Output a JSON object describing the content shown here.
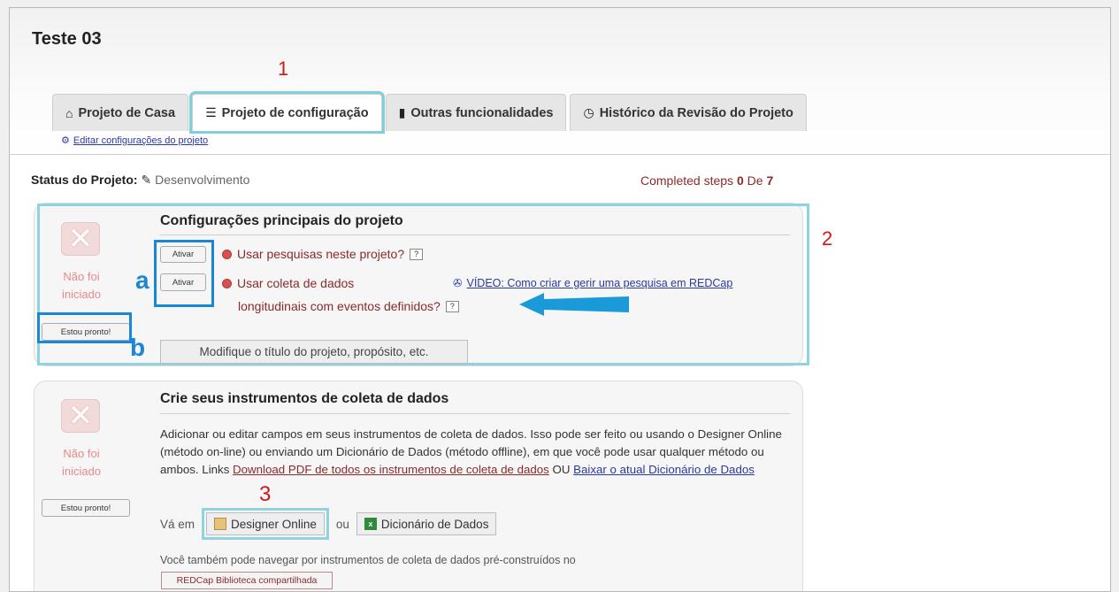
{
  "project": {
    "title": "Teste 03"
  },
  "tabs": [
    {
      "label": "Projeto de Casa",
      "icon": "home-icon"
    },
    {
      "label": "Projeto de configuração",
      "icon": "list-icon"
    },
    {
      "label": "Outras funcionalidades",
      "icon": "book-icon"
    },
    {
      "label": "Histórico da Revisão do Projeto",
      "icon": "history-icon"
    }
  ],
  "edit_settings_link": "Editar configurações do projeto",
  "status": {
    "label": "Status do Projeto:",
    "value": "Desenvolvimento"
  },
  "steps": {
    "prefix": "Completed steps",
    "done": "0",
    "sep": "De",
    "total": "7"
  },
  "annotations": {
    "n1": "1",
    "n2": "2",
    "n3": "3",
    "a": "a",
    "b": "b"
  },
  "section1": {
    "title": "Configurações principais do projeto",
    "status_text_1": "Não foi",
    "status_text_2": "iniciado",
    "ready_button": "Estou pronto!",
    "activate_button": "Ativar",
    "question_1": "Usar pesquisas neste projeto?",
    "question_2_line1": "Usar coleta de dados",
    "question_2_line2": "longitudinais com eventos definidos?",
    "help": "?",
    "video_link": "VÍDEO: Como criar e gerir uma pesquisa em REDCap",
    "modify_button": "Modifique o título do projeto, propósito, etc."
  },
  "section2": {
    "title": "Crie seus instrumentos de coleta de dados",
    "status_text_1": "Não foi",
    "status_text_2": "iniciado",
    "ready_button": "Estou pronto!",
    "description": "Adicionar ou editar campos em seus instrumentos de coleta de dados. Isso pode ser feito ou usando o Designer Online (método on-line) ou enviando um Dicionário de Dados (método offline), em que você pode usar qualquer método ou ambos. Links",
    "pdf_link": "Download PDF de todos os instrumentos de coleta de dados",
    "or_text": "OU",
    "dict_link": "Baixar o atual Dicionário de Dados",
    "go_label": "Vá em",
    "designer_button": "Designer Online",
    "or_small": "ou",
    "dictionary_button": "Dicionário de Dados",
    "library_text": "Você também pode navegar por instrumentos de coleta de dados pré-construídos no",
    "library_button": "REDCap Biblioteca compartilhada"
  }
}
